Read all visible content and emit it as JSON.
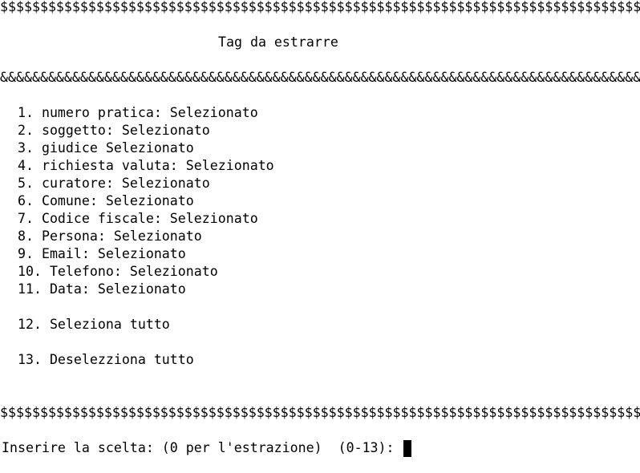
{
  "header": {
    "top_rule": "$$$$$$$$$$$$$$$$$$$$$$$$$$$$$$$$$$$$$$$$$$$$$$$$$$$$$$$$$$$$$$$$$$$$$$$$$$$$$$$$$$$$$$$",
    "title": "Tag da estrarre",
    "title_rule": "&&&&&&&&&&&&&&&&&&&&&&&&&&&&&&&&&&&&&&&&&&&&&&&&&&&&&&&&&&&&&&&&&&&&&&&&&&&&&&&&&&&&&&&&&&&"
  },
  "menu": {
    "items": [
      {
        "text": "  1. numero pratica: Selezionato"
      },
      {
        "text": "  2. soggetto: Selezionato"
      },
      {
        "text": "  3. giudice Selezionato"
      },
      {
        "text": "  4. richiesta valuta: Selezionato"
      },
      {
        "text": "  5. curatore: Selezionato"
      },
      {
        "text": "  6. Comune: Selezionato"
      },
      {
        "text": "  7. Codice fiscale: Selezionato"
      },
      {
        "text": "  8. Persona: Selezionato"
      },
      {
        "text": "  9. Email: Selezionato"
      },
      {
        "text": "  10. Telefono: Selezionato"
      },
      {
        "text": "  11. Data: Selezionato"
      }
    ],
    "select_all": "  12. Seleziona tutto",
    "deselect_all": "  13. Deselezziona tutto"
  },
  "footer": {
    "bottom_rule": "$$$$$$$$$$$$$$$$$$$$$$$$$$$$$$$$$$$$$$$$$$$$$$$$$$$$$$$$$$$$$$$$$$$$$$$$$$$$$$$$$$$$$$$",
    "prompt": "Inserire la scelta: (0 per l'estrazione)  (0-13): ",
    "input_value": ""
  }
}
